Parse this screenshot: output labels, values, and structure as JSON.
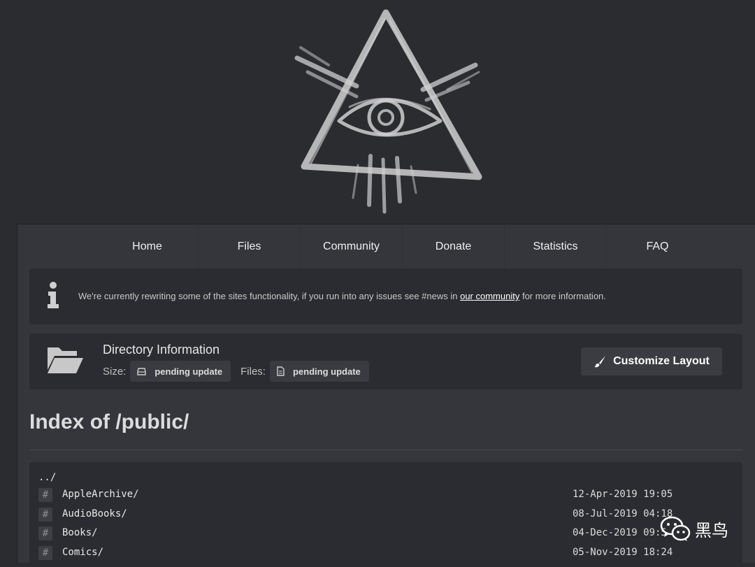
{
  "nav": {
    "items": [
      "Home",
      "Files",
      "Community",
      "Donate",
      "Statistics",
      "FAQ"
    ]
  },
  "notice": {
    "text_before": "We're currently rewriting some of the sites functionality, if you run into any issues see #news in ",
    "link_text": "our community",
    "text_after": " for more information."
  },
  "directory": {
    "title": "Directory Information",
    "size_label": "Size:",
    "size_value": "pending update",
    "files_label": "Files:",
    "files_value": "pending update",
    "customize_label": "Customize Layout"
  },
  "index": {
    "title": "Index of /public/",
    "parent": "../",
    "entries": [
      {
        "icon": "#",
        "name": "AppleArchive/",
        "date": "12-Apr-2019 19:05"
      },
      {
        "icon": "#",
        "name": "AudioBooks/",
        "date": "08-Jul-2019 04:18"
      },
      {
        "icon": "#",
        "name": "Books/",
        "date": "04-Dec-2019 09:5"
      },
      {
        "icon": "#",
        "name": "Comics/",
        "date": "05-Nov-2019 18:24"
      }
    ]
  },
  "watermark": {
    "text": "黑鸟"
  },
  "colors": {
    "background": "#2b2c30",
    "panel": "#34363b",
    "card": "#2b2c31"
  },
  "icons": [
    "eye-triangle-logo",
    "info-icon",
    "folder-open-icon",
    "drive-icon",
    "file-icon",
    "paintbrush-icon",
    "hash-icon",
    "wechat-icon"
  ]
}
